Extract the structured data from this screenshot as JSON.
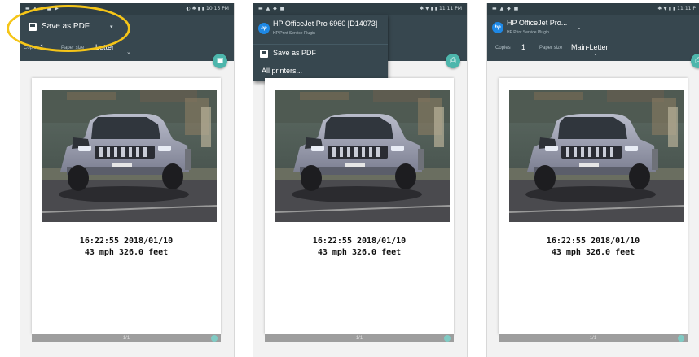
{
  "screens": [
    {
      "status": {
        "left_icons": "▬ ▲ ◆ ■ ▶",
        "right_text": "◐ ✱ ▮ ▮ 10:15 PM"
      },
      "printer": {
        "name": "Save as PDF",
        "caret": "▾"
      },
      "options": {
        "copies_label": "Copies",
        "copies_value": "1",
        "paper_label": "Paper size",
        "paper_value": "Letter",
        "caret": "⌄"
      },
      "fab_icon": "▣",
      "preview": {
        "line1": "16:22:55 2018/01/10",
        "line2": "43 mph 326.0 feet",
        "page": "1/1"
      }
    },
    {
      "status": {
        "left_icons": "▬ ▲ ◆ ■",
        "right_text": "✱ ▼ ▮ ▮ 11:11 PM"
      },
      "menu": {
        "printer_name": "HP OfficeJet Pro 6960 [D14073]",
        "printer_sub": "HP Print Service Plugin",
        "save_pdf": "Save as PDF",
        "all_printers": "All printers..."
      },
      "fab_icon": "⎙",
      "preview": {
        "line1": "16:22:55 2018/01/10",
        "line2": "43 mph 326.0 feet",
        "page": "1/1"
      }
    },
    {
      "status": {
        "left_icons": "▬ ▲ ◆ ■",
        "right_text": "✱ ▼ ▮ ▮ 11:11 P"
      },
      "printer": {
        "name": "HP OfficeJet Pro...",
        "sub": "HP Print Service Plugin",
        "caret": "⌄"
      },
      "options": {
        "copies_label": "Copies",
        "copies_value": "1",
        "paper_label": "Paper size",
        "paper_value": "Main-Letter",
        "caret": "⌄"
      },
      "fab_icon": "⎙",
      "preview": {
        "line1": "16:22:55 2018/01/10",
        "line2": "43 mph 326.0 feet",
        "page": "1/1"
      }
    }
  ],
  "hp_logo_text": "hp",
  "colors": {
    "toolbar": "#37474f",
    "fab": "#4db6ac",
    "highlight": "#f5c518"
  }
}
